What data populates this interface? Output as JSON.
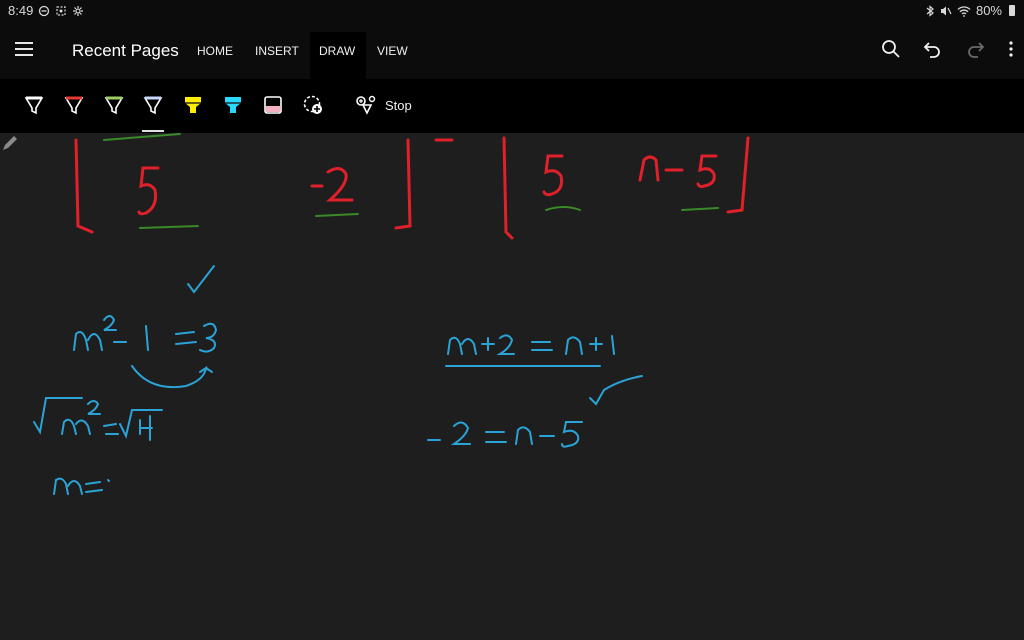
{
  "status": {
    "time": "8:49",
    "battery": "80%",
    "icons_left": [
      "dnd-icon",
      "screen-icon",
      "settings-icon"
    ],
    "icons_right": [
      "bluetooth-icon",
      "mute-icon",
      "wifi-icon",
      "battery-icon"
    ]
  },
  "app": {
    "title": "Recent Pages",
    "tabs": [
      {
        "label": "HOME"
      },
      {
        "label": "INSERT"
      },
      {
        "label": "DRAW",
        "active": true
      },
      {
        "label": "VIEW"
      }
    ],
    "actions": [
      "search-icon",
      "undo-icon",
      "redo-icon",
      "more-icon"
    ]
  },
  "ribbon": {
    "tools": [
      {
        "name": "pen-white",
        "color": "#ffffff"
      },
      {
        "name": "pen-red",
        "color": "#e53935"
      },
      {
        "name": "pen-green",
        "color": "#9ccc65"
      },
      {
        "name": "pen-light-blue",
        "color": "#c8d6ff",
        "selected": true
      },
      {
        "name": "highlighter-yellow",
        "color": "#ffee00"
      },
      {
        "name": "highlighter-cyan",
        "color": "#29d8ff"
      },
      {
        "name": "highlighter-pink",
        "color": "#f3b1c3"
      },
      {
        "name": "lasso-add",
        "color": "#ffffff"
      },
      {
        "name": "ink-to-shape",
        "color": "#ffffff"
      }
    ],
    "stop_label": "Stop"
  },
  "canvas": {
    "ink_colors": {
      "red": "#e0202a",
      "blue": "#2aa3d6",
      "green": "#3a8a2a"
    }
  }
}
